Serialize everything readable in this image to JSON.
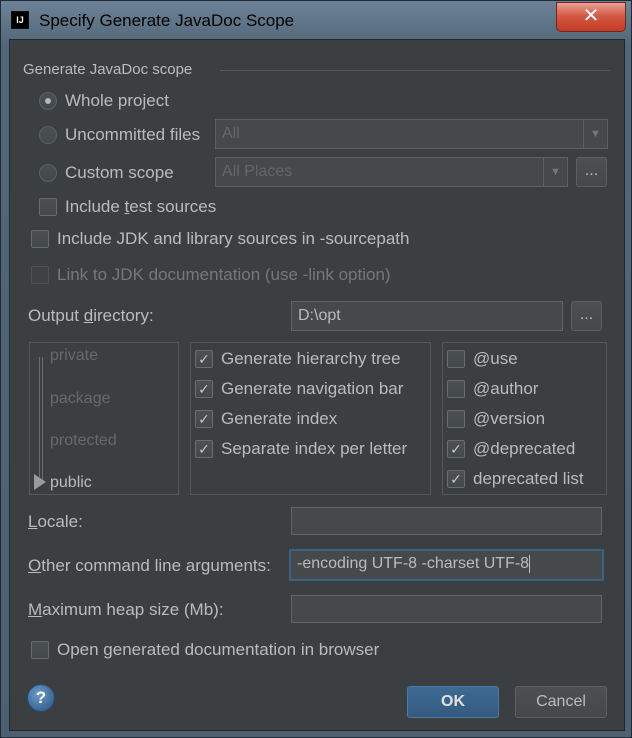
{
  "window": {
    "app_icon": "IJ",
    "title": "Specify Generate JavaDoc Scope",
    "close_glyph": "✕"
  },
  "scope_group": {
    "title": "Generate JavaDoc scope",
    "whole_project": "Whole project",
    "uncommitted_files": "Uncommitted files",
    "uncommitted_combo_value": "All",
    "custom_scope": "Custom scope",
    "custom_combo_value": "All Places",
    "browse_label": "...",
    "include_test_sources": "Include test sources",
    "selected": "whole_project"
  },
  "options": {
    "include_jdk": "Include JDK and library sources in -sourcepath",
    "link_jdk": "Link to JDK documentation (use -link option)"
  },
  "output": {
    "label": "Output directory:",
    "value": "D:\\opt",
    "browse_label": "..."
  },
  "visibility": {
    "levels": [
      "private",
      "package",
      "protected",
      "public"
    ],
    "selected": "public"
  },
  "generate_options": [
    {
      "label": "Generate hierarchy tree",
      "checked": true
    },
    {
      "label": "Generate navigation bar",
      "checked": true
    },
    {
      "label": "Generate index",
      "checked": true
    },
    {
      "label": "Separate index per letter",
      "checked": true
    }
  ],
  "tag_options": [
    {
      "label": "@use",
      "checked": false
    },
    {
      "label": "@author",
      "checked": false
    },
    {
      "label": "@version",
      "checked": false
    },
    {
      "label": "@deprecated",
      "checked": true
    },
    {
      "label": "deprecated list",
      "checked": true
    }
  ],
  "locale": {
    "label": "Locale:",
    "value": ""
  },
  "other_args": {
    "label": "Other command line arguments:",
    "value": "-encoding UTF-8  -charset UTF-8"
  },
  "max_heap": {
    "label": "Maximum heap size (Mb):",
    "value": ""
  },
  "open_browser": {
    "label": "Open generated documentation in browser",
    "checked": false
  },
  "footer": {
    "help_glyph": "?",
    "ok": "OK",
    "cancel": "Cancel"
  },
  "check_glyph": "✓"
}
